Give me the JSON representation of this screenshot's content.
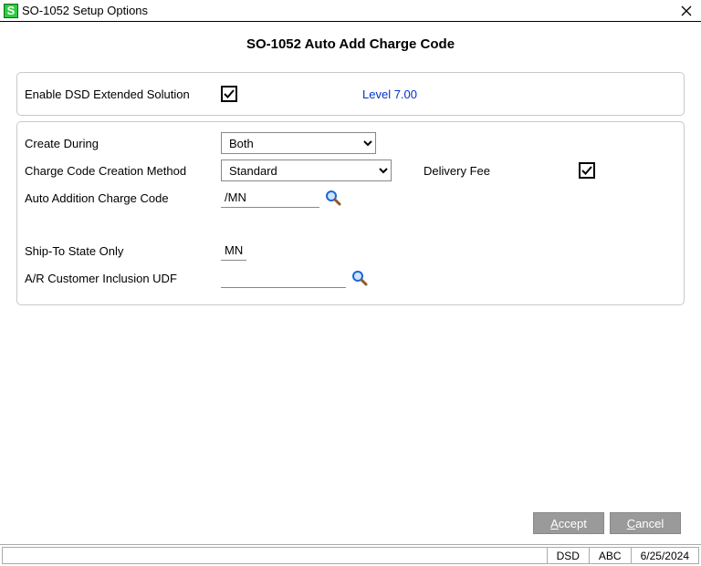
{
  "window": {
    "title": "SO-1052 Setup Options",
    "heading": "SO-1052 Auto Add Charge Code"
  },
  "panel1": {
    "enable_label": "Enable DSD Extended Solution",
    "level_text": "Level  7.00"
  },
  "panel2": {
    "create_during_label": "Create During",
    "create_during_value": "Both",
    "method_label": "Charge Code Creation Method",
    "method_value": "Standard",
    "delivery_fee_label": "Delivery Fee",
    "auto_code_label": "Auto Addition Charge Code",
    "auto_code_value": "/MN",
    "shipto_label": "Ship-To State Only",
    "shipto_value": "MN",
    "ar_udf_label": "A/R Customer Inclusion UDF",
    "ar_udf_value": ""
  },
  "buttons": {
    "accept": "ccept",
    "accept_ul": "A",
    "cancel": "ancel",
    "cancel_ul": "C"
  },
  "status": {
    "dsd": "DSD",
    "abc": "ABC",
    "date": "6/25/2024"
  }
}
